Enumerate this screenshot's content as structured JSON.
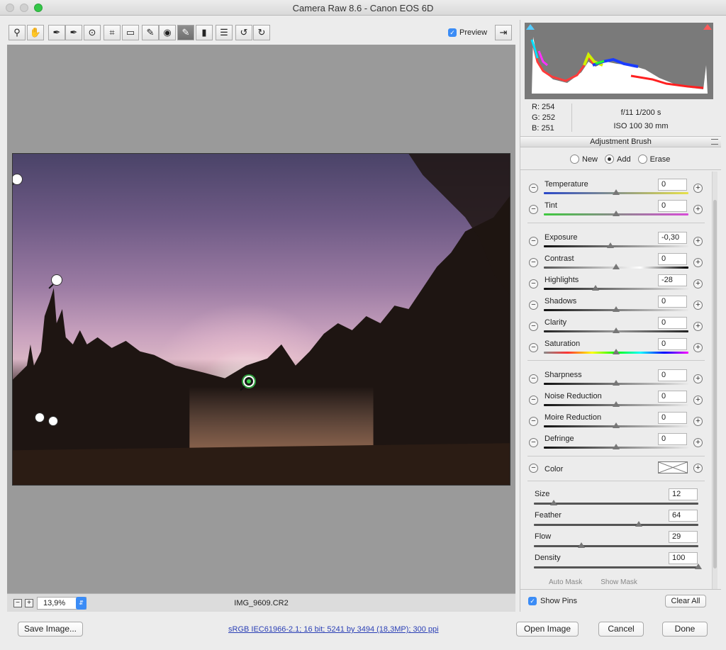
{
  "window": {
    "title": "Camera Raw 8.6  -  Canon EOS 6D"
  },
  "toolbar": {
    "tools": [
      {
        "name": "zoom-tool",
        "glyph": "🔍︎"
      },
      {
        "name": "hand-tool",
        "glyph": "✋"
      },
      {
        "name": "white-balance-tool",
        "glyph": "✒"
      },
      {
        "name": "color-sampler-tool",
        "glyph": "✒"
      },
      {
        "name": "targeted-adjustment-tool",
        "glyph": "⊙"
      },
      {
        "name": "crop-tool",
        "glyph": "⌗"
      },
      {
        "name": "straighten-tool",
        "glyph": "▭"
      },
      {
        "name": "spot-removal-tool",
        "glyph": "✎"
      },
      {
        "name": "red-eye-tool",
        "glyph": "👁"
      },
      {
        "name": "adjustment-brush-tool",
        "glyph": "✎"
      },
      {
        "name": "graduated-filter-tool",
        "glyph": "▮"
      },
      {
        "name": "preferences-tool",
        "glyph": "☰"
      },
      {
        "name": "rotate-left-tool",
        "glyph": "↺"
      },
      {
        "name": "rotate-right-tool",
        "glyph": "↻"
      }
    ],
    "preview_label": "Preview"
  },
  "canvas": {
    "zoom_value": "13,9%",
    "filename": "IMG_9609.CR2"
  },
  "histogram": {
    "r": "R:  254",
    "g": "G:  252",
    "b": "B:  251",
    "aperture_shutter": "f/11    1/200 s",
    "iso_focal": "ISO 100    30 mm"
  },
  "brush": {
    "section_title": "Adjustment Brush",
    "mode_new": "New",
    "mode_add": "Add",
    "mode_erase": "Erase",
    "adjustments": [
      {
        "label": "Temperature",
        "value": "0",
        "pos": 0.5
      },
      {
        "label": "Tint",
        "value": "0",
        "pos": 0.5
      },
      {
        "label": "Exposure",
        "value": "-0,30",
        "pos": 0.46
      },
      {
        "label": "Contrast",
        "value": "0",
        "pos": 0.5
      },
      {
        "label": "Highlights",
        "value": "-28",
        "pos": 0.36
      },
      {
        "label": "Shadows",
        "value": "0",
        "pos": 0.5
      },
      {
        "label": "Clarity",
        "value": "0",
        "pos": 0.5
      },
      {
        "label": "Saturation",
        "value": "0",
        "pos": 0.5
      },
      {
        "label": "Sharpness",
        "value": "0",
        "pos": 0.5
      },
      {
        "label": "Noise Reduction",
        "value": "0",
        "pos": 0.5
      },
      {
        "label": "Moire Reduction",
        "value": "0",
        "pos": 0.5
      },
      {
        "label": "Defringe",
        "value": "0",
        "pos": 0.5
      }
    ],
    "color_label": "Color",
    "brush_settings": [
      {
        "label": "Size",
        "value": "12",
        "pos": 0.12
      },
      {
        "label": "Feather",
        "value": "64",
        "pos": 0.64
      },
      {
        "label": "Flow",
        "value": "29",
        "pos": 0.29
      },
      {
        "label": "Density",
        "value": "100",
        "pos": 1.0
      }
    ],
    "auto_mask": "Auto Mask",
    "show_mask": "Show Mask",
    "show_pins": "Show Pins",
    "clear_all": "Clear All"
  },
  "footer": {
    "save_image": "Save Image...",
    "workflow_link": "sRGB IEC61966-2.1; 16 bit; 5241 by 3494 (18,3MP); 300 ppi",
    "open_image": "Open Image",
    "cancel": "Cancel",
    "done": "Done"
  }
}
